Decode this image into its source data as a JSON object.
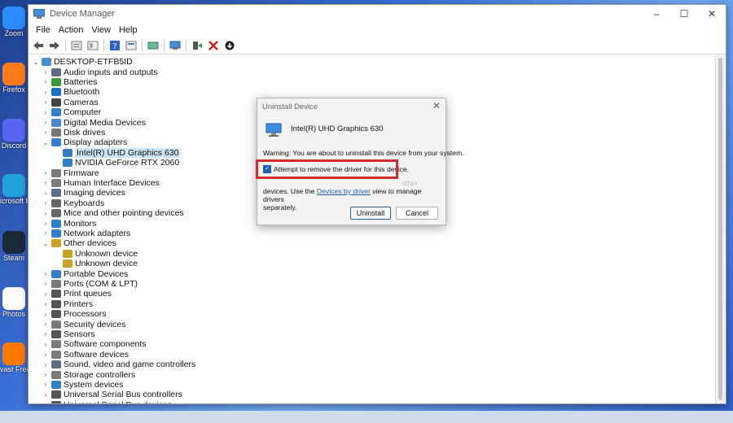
{
  "desktop": {
    "icons": [
      {
        "label": "Zoom",
        "icon": "zoom-icon",
        "color": "#2d8cff"
      },
      {
        "label": "Firefox",
        "icon": "firefox-icon",
        "color": "#ff7a18"
      },
      {
        "label": "Discord",
        "icon": "discord-icon",
        "color": "#5865f2"
      },
      {
        "label": "Microsoft Edge",
        "icon": "edge-icon",
        "color": "#1fa3d9"
      },
      {
        "label": "Steam",
        "icon": "steam-icon",
        "color": "#1b2838"
      },
      {
        "label": "Photos",
        "icon": "photos-icon",
        "color": "#ffffff"
      },
      {
        "label": "Avast Free Antivirus",
        "icon": "avast-icon",
        "color": "#ff7800"
      }
    ],
    "icon_labels_visible": [
      "Zoom",
      "Firefox",
      "Discord",
      "icrosoft Edge",
      "Steam",
      "Photos",
      "vast Free ntivirus"
    ]
  },
  "window": {
    "title": "Device Manager",
    "controls": {
      "minimize": "–",
      "maximize": "☐",
      "close": "✕"
    },
    "menu": [
      "File",
      "Action",
      "View",
      "Help"
    ],
    "toolbar": [
      "back-icon",
      "forward-icon",
      "properties-icon",
      "show-hidden-icon",
      "help-icon",
      "scan-changes-icon",
      "update-driver-icon",
      "add-legacy-icon",
      "enable-device-icon",
      "uninstall-device-icon",
      "download-icon"
    ],
    "tree": {
      "root": "DESKTOP-ETFB5ID",
      "items": [
        {
          "label": "Audio inputs and outputs",
          "expanded": false,
          "color": "#5a6e84"
        },
        {
          "label": "Batteries",
          "expanded": false,
          "color": "#3c9a3c"
        },
        {
          "label": "Bluetooth",
          "expanded": false,
          "color": "#1a6fd1"
        },
        {
          "label": "Cameras",
          "expanded": false,
          "color": "#444444"
        },
        {
          "label": "Computer",
          "expanded": false,
          "color": "#2f7fc9"
        },
        {
          "label": "Digital Media Devices",
          "expanded": false,
          "color": "#4b8ad0"
        },
        {
          "label": "Disk drives",
          "expanded": false,
          "color": "#777777"
        },
        {
          "label": "Display adapters",
          "expanded": true,
          "color": "#2f7fc9",
          "children": [
            {
              "label": "Intel(R) UHD Graphics 630",
              "selected": true
            },
            {
              "label": "NVIDIA GeForce RTX 2060",
              "selected": false
            }
          ]
        },
        {
          "label": "Firmware",
          "expanded": false,
          "color": "#7a7a7a"
        },
        {
          "label": "Human Interface Devices",
          "expanded": false,
          "color": "#7a7a7a"
        },
        {
          "label": "Imaging devices",
          "expanded": false,
          "color": "#5a6e84"
        },
        {
          "label": "Keyboards",
          "expanded": false,
          "color": "#666666"
        },
        {
          "label": "Mice and other pointing devices",
          "expanded": false,
          "color": "#666666"
        },
        {
          "label": "Monitors",
          "expanded": false,
          "color": "#2f7fc9"
        },
        {
          "label": "Network adapters",
          "expanded": false,
          "color": "#2f7fc9"
        },
        {
          "label": "Other devices",
          "expanded": true,
          "color": "#c9a227",
          "children": [
            {
              "label": "Unknown device",
              "selected": false
            },
            {
              "label": "Unknown device",
              "selected": false
            }
          ]
        },
        {
          "label": "Portable Devices",
          "expanded": false,
          "color": "#2f7fc9"
        },
        {
          "label": "Ports (COM & LPT)",
          "expanded": false,
          "color": "#7a7a7a"
        },
        {
          "label": "Print queues",
          "expanded": false,
          "color": "#555555"
        },
        {
          "label": "Printers",
          "expanded": false,
          "color": "#555555"
        },
        {
          "label": "Processors",
          "expanded": false,
          "color": "#555555"
        },
        {
          "label": "Security devices",
          "expanded": false,
          "color": "#7a7a7a"
        },
        {
          "label": "Sensors",
          "expanded": false,
          "color": "#555555"
        },
        {
          "label": "Software components",
          "expanded": false,
          "color": "#7a7a7a"
        },
        {
          "label": "Software devices",
          "expanded": false,
          "color": "#7a7a7a"
        },
        {
          "label": "Sound, video and game controllers",
          "expanded": false,
          "color": "#5a6e84"
        },
        {
          "label": "Storage controllers",
          "expanded": false,
          "color": "#7a7a7a"
        },
        {
          "label": "System devices",
          "expanded": false,
          "color": "#2f7fc9"
        },
        {
          "label": "Universal Serial Bus controllers",
          "expanded": false,
          "color": "#555555"
        },
        {
          "label": "Universal Serial Bus devices",
          "expanded": false,
          "color": "#555555"
        }
      ]
    }
  },
  "dialog": {
    "title": "Uninstall Device",
    "close": "✕",
    "device_name": "Intel(R) UHD Graphics 630",
    "warning": "Warning: You are about to uninstall this device from your system.",
    "checkbox_label": "Attempt to remove the driver for this device.",
    "checkbox_checked": true,
    "note_line1_fragment": "other",
    "note_line2_prefix": "devices. Use the ",
    "note_link": "Devices by driver",
    "note_line2_suffix": " view to manage drivers",
    "note_line3": "separately.",
    "uninstall_button": "Uninstall",
    "cancel_button": "Cancel",
    "highlight_color": "#d12b2b"
  }
}
